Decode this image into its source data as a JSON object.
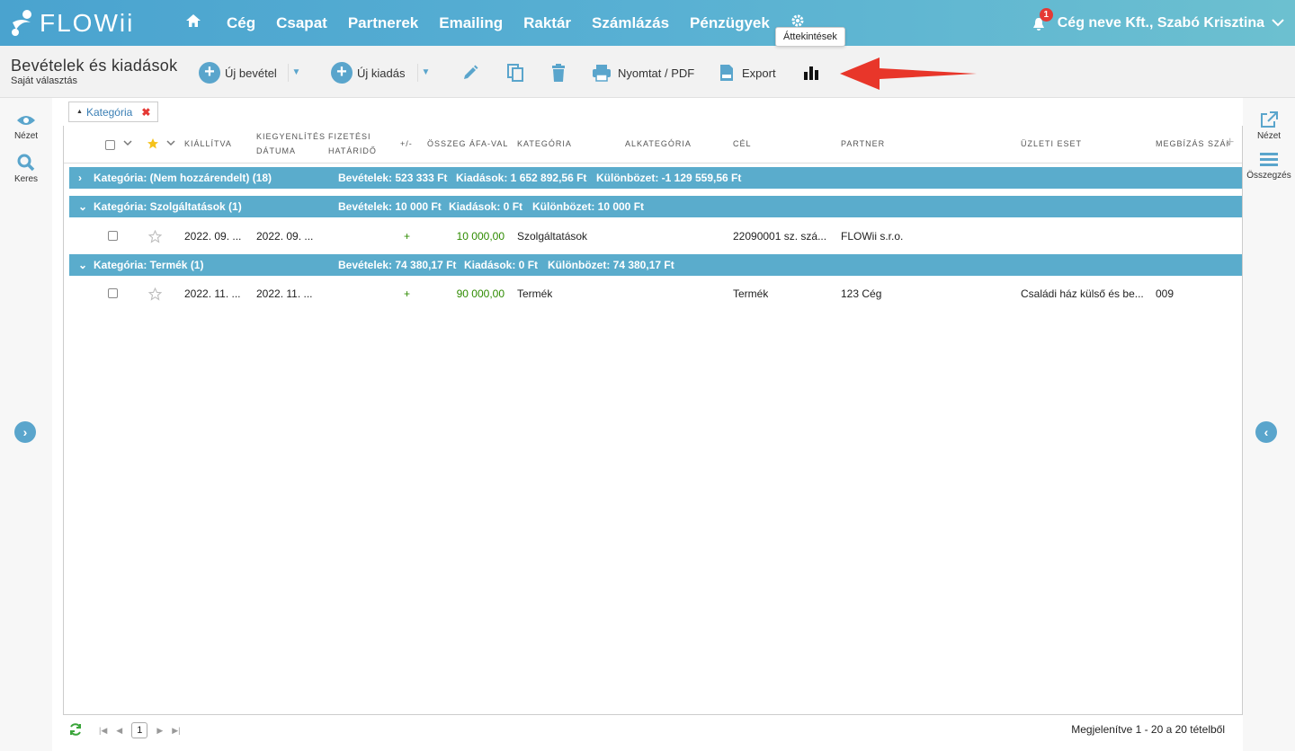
{
  "app": {
    "logo_text": "FLOWii"
  },
  "nav": {
    "items": [
      "Cég",
      "Csapat",
      "Partnerek",
      "Emailing",
      "Raktár",
      "Számlázás",
      "Pénzügyek"
    ],
    "notification_count": "1",
    "user_label": "Cég neve Kft., Szabó Krisztina"
  },
  "toolbar": {
    "title": "Bevételek és kiadások",
    "subtitle": "Saját választás",
    "new_income": "Új bevétel",
    "new_expense": "Új kiadás",
    "print": "Nyomtat / PDF",
    "export": "Export",
    "tooltip": "Áttekintések"
  },
  "left_sidebar": {
    "view": "Nézet",
    "search": "Keres"
  },
  "right_sidebar": {
    "view": "Nézet",
    "summary": "Összegzés"
  },
  "filter": {
    "chip_label": "Kategória"
  },
  "columns": {
    "issued": "Kiállítva",
    "settle_1": "Kiegyenlítés",
    "settle_2": "dátuma",
    "due_1": "Fizetési",
    "due_2": "határidő",
    "sign": "+/-",
    "amount": "Összeg áfa-val",
    "category": "Kategória",
    "subcategory": "Alkategória",
    "goal": "Cél",
    "partner": "Partner",
    "business_case": "Üzleti eset",
    "order": "Megbízás szám"
  },
  "groups": [
    {
      "title": "Kategória: (Nem hozzárendelt) (18)",
      "income": "Bevételek: 523 333 Ft",
      "expense": "Kiadások: 1 652 892,56 Ft",
      "diff": "Különbözet: -1 129 559,56 Ft",
      "expanded": false
    },
    {
      "title": "Kategória: Szolgáltatások (1)",
      "income": "Bevételek: 10 000 Ft",
      "expense": "Kiadások: 0 Ft",
      "diff": "Különbözet: 10 000 Ft",
      "expanded": true
    },
    {
      "title": "Kategória: Termék (1)",
      "income": "Bevételek: 74 380,17 Ft",
      "expense": "Kiadások: 0 Ft",
      "diff": "Különbözet: 74 380,17 Ft",
      "expanded": true
    }
  ],
  "rows": [
    {
      "issued": "2022. 09. ...",
      "settle": "2022. 09. ...",
      "sign": "+",
      "amount": "10 000,00",
      "category": "Szolgáltatások",
      "goal": "22090001 sz. szá...",
      "partner": "FLOWii s.r.o.",
      "business_case": "",
      "order": ""
    },
    {
      "issued": "2022. 11. ...",
      "settle": "2022. 11. ...",
      "sign": "+",
      "amount": "90 000,00",
      "category": "Termék",
      "goal": "Termék",
      "partner": "123 Cég",
      "business_case": "Családi ház külső és be...",
      "order": "009"
    }
  ],
  "footer": {
    "page": "1",
    "summary": "Megjelenítve 1 - 20 a 20 tételből"
  },
  "colors": {
    "accent": "#5aa5cc",
    "group": "#5aaccc",
    "arrow": "#e8362a"
  }
}
